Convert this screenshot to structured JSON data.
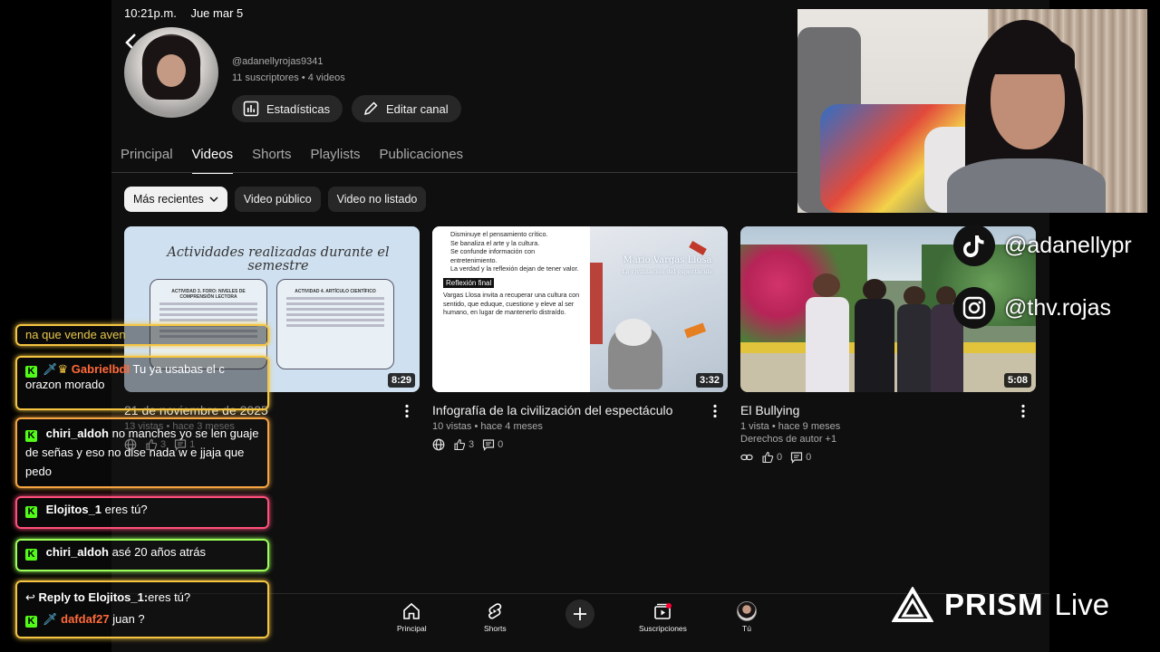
{
  "status_bar": {
    "time": "10:21p.m.",
    "date": "Jue mar 5"
  },
  "channel": {
    "handle": "@adanellyrojas9341",
    "meta": "11 suscriptores • 4 videos",
    "stats_label": "Estadísticas",
    "edit_label": "Editar canal"
  },
  "tabs": [
    {
      "label": "Principal"
    },
    {
      "label": "Videos"
    },
    {
      "label": "Shorts"
    },
    {
      "label": "Playlists"
    },
    {
      "label": "Publicaciones"
    }
  ],
  "filters": {
    "sort": "Más recientes",
    "public": "Video público",
    "unlisted": "Video no listado"
  },
  "videos": [
    {
      "title": "21 de noviembre de 2025",
      "meta": "13 vistas • hace 3 meses",
      "likes": "3",
      "comments": "1",
      "duration": "8:29",
      "thumb_title": "Actividades realizadas durante el semestre",
      "box1": "ACTIVIDAD 3. FORO: NIVELES DE COMPRENSIÓN LECTORA",
      "box2": "ACTIVIDAD 4. ARTÍCULO CIENTÍFICO"
    },
    {
      "title": "Infografía de la civilización del espectáculo",
      "meta": "10 vistas • hace 4 meses",
      "likes": "3",
      "comments": "0",
      "duration": "3:32",
      "bullets": [
        "Disminuye el pensamiento crítico.",
        "Se banaliza el arte y la cultura.",
        "Se confunde información con entretenimiento.",
        "La verdad y la reflexión dejan de tener valor."
      ],
      "reflex_title": "Reflexión final",
      "reflex_text": "Vargas Llosa invita a recuperar una cultura con sentido, que eduque, cuestione y eleve al ser humano, en lugar de mantenerlo distraído.",
      "book_author": "Mario Vargas Llosa",
      "book_title": "La civilización del espectáculo"
    },
    {
      "title": "El Bullying",
      "meta": "1 vista • hace 9 meses",
      "extra": "Derechos de autor +1",
      "likes": "0",
      "comments": "0",
      "duration": "5:08"
    }
  ],
  "bottom_nav": [
    {
      "label": "Principal",
      "icon": "home-icon"
    },
    {
      "label": "Shorts",
      "icon": "shorts-icon"
    },
    {
      "label": "",
      "icon": "plus-icon"
    },
    {
      "label": "Suscripciones",
      "icon": "subscriptions-icon"
    },
    {
      "label": "Tú",
      "icon": "avatar-icon"
    }
  ],
  "social": {
    "tiktok": "@adanellypr",
    "instagram": "@thv.rojas"
  },
  "chat": [
    {
      "text": "na que vende aven",
      "border": "#f5c542"
    },
    {
      "user": "GabrielbdI",
      "text": "Tu ya usabas el c orazon morado",
      "border": "#f5c542"
    },
    {
      "user": "chiri_aldoh",
      "text": "no manches yo se len guaje de señas y eso no dise nada w e jjaja que pedo",
      "border": "#f5a542"
    },
    {
      "user": "Elojitos_1",
      "text": "eres tú?",
      "border": "#ff4f7a"
    },
    {
      "user": "chiri_aldoh",
      "text": "asé 20 años atrás",
      "border": "#9cff5a"
    },
    {
      "reply": "Reply to Elojitos_1:",
      "reply_text": "eres tú?",
      "user": "dafdaf27",
      "text": "juan ?",
      "border": "#f5c542"
    }
  ],
  "branding": {
    "prism": "PRISM",
    "live": "Live"
  }
}
